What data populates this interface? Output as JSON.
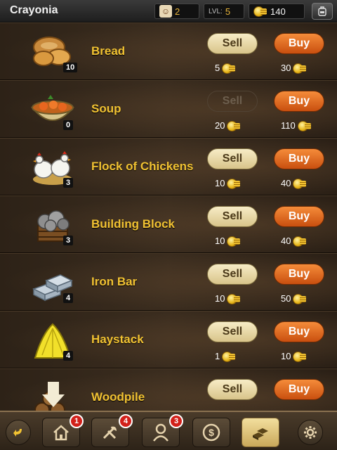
{
  "header": {
    "title": "Crayonia",
    "workers": "2",
    "level_label": "LVL:",
    "level": "5",
    "coins": "140"
  },
  "items": [
    {
      "name": "Bread",
      "count": "10",
      "sell_label": "Sell",
      "sell_price": "5",
      "buy_label": "Buy",
      "buy_price": "30",
      "sell_enabled": true
    },
    {
      "name": "Soup",
      "count": "0",
      "sell_label": "Sell",
      "sell_price": "20",
      "buy_label": "Buy",
      "buy_price": "110",
      "sell_enabled": false
    },
    {
      "name": "Flock of Chickens",
      "count": "3",
      "sell_label": "Sell",
      "sell_price": "10",
      "buy_label": "Buy",
      "buy_price": "40",
      "sell_enabled": true
    },
    {
      "name": "Building Block",
      "count": "3",
      "sell_label": "Sell",
      "sell_price": "10",
      "buy_label": "Buy",
      "buy_price": "40",
      "sell_enabled": true
    },
    {
      "name": "Iron Bar",
      "count": "4",
      "sell_label": "Sell",
      "sell_price": "10",
      "buy_label": "Buy",
      "buy_price": "50",
      "sell_enabled": true
    },
    {
      "name": "Haystack",
      "count": "4",
      "sell_label": "Sell",
      "sell_price": "1",
      "buy_label": "Buy",
      "buy_price": "10",
      "sell_enabled": true
    },
    {
      "name": "Woodpile",
      "count": "",
      "sell_label": "Sell",
      "sell_price": "",
      "buy_label": "Buy",
      "buy_price": "",
      "sell_enabled": true
    }
  ],
  "nav": {
    "houses_badge": "1",
    "tools_badge": "4",
    "workers_badge": "3"
  },
  "colors": {
    "accent_gold": "#f1c232",
    "buy_orange": "#e0661f",
    "badge_red": "#d2201a"
  },
  "icons": [
    "back-arrow-icon",
    "house-icon",
    "tools-icon",
    "worker-icon",
    "coin-exchange-icon",
    "gold-bars-icon",
    "gear-icon",
    "backpack-icon"
  ]
}
